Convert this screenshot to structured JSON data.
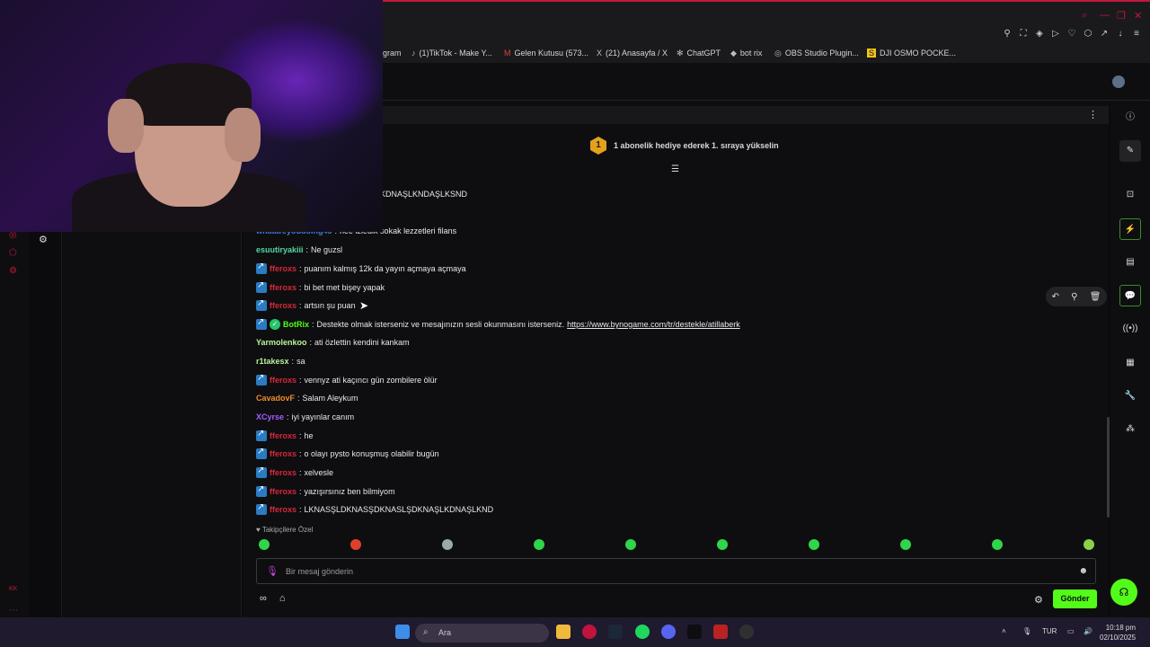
{
  "bookmarks": [
    {
      "label": "gram",
      "icon": ""
    },
    {
      "label": "(1)TikTok - Make Y...",
      "icon": "♪"
    },
    {
      "label": "Gelen Kutusu (573...",
      "icon": "M"
    },
    {
      "label": "(21) Anasayfa / X",
      "icon": "X"
    },
    {
      "label": "ChatGPT",
      "icon": "✻"
    },
    {
      "label": "bot rix",
      "icon": "◆"
    },
    {
      "label": "OBS Studio Plugin...",
      "icon": "◎"
    },
    {
      "label": "DJI OSMO POCKE...",
      "icon": "S"
    }
  ],
  "pinned": {
    "badge": "1",
    "text": "1 abonelik hediye ederek 1. sıraya yükselin"
  },
  "partial_line": "KDNAŞLKNDAŞLKSND",
  "messages": [
    {
      "user": "whatareyoudoing45",
      "color": "#3d7fe0",
      "text": "nee izledik sokak lezzetleri filans"
    },
    {
      "user": "esuutiryakiii",
      "color": "#55d6a0",
      "text": "Ne guzsl"
    },
    {
      "user": "fferoxs",
      "color": "#d6283c",
      "text": "puanım kalmış 12k da yayın açmaya açmaya",
      "badge": true
    },
    {
      "user": "fferoxs",
      "color": "#d6283c",
      "text": "bi bet met bişey yapak",
      "badge": true
    },
    {
      "user": "fferoxs",
      "color": "#d6283c",
      "text": "artsın şu puan",
      "badge": true
    },
    {
      "user": "BotRix",
      "color": "#53fc18",
      "text": "Destekte olmak isterseniz ve mesajınızın sesli okunmasını isterseniz.",
      "link": "https://www.bynogame.com/tr/destekle/atillaberk",
      "badge": true,
      "verified": true
    },
    {
      "user": "Yarmolenkoo",
      "color": "#b9f29a",
      "text": "ati özlettin kendini kankam"
    },
    {
      "user": "r1takesx",
      "color": "#b9f29a",
      "text": "sa"
    },
    {
      "user": "fferoxs",
      "color": "#d6283c",
      "text": "vennyz ati kaçıncı gün zombilere ölür",
      "badge": true
    },
    {
      "user": "CavadovF",
      "color": "#f08a2a",
      "text": "Salam Aleykum"
    },
    {
      "user": "XCyrse",
      "color": "#a35cff",
      "text": "iyi yayınlar canım"
    },
    {
      "user": "fferoxs",
      "color": "#d6283c",
      "text": "he",
      "badge": true
    },
    {
      "user": "fferoxs",
      "color": "#d6283c",
      "text": "o olayı pysto konuşmuş olabilir bugün",
      "badge": true
    },
    {
      "user": "fferoxs",
      "color": "#d6283c",
      "text": "xelvesle",
      "badge": true
    },
    {
      "user": "fferoxs",
      "color": "#d6283c",
      "text": "yazışırsınız ben bilmiyom",
      "badge": true
    },
    {
      "user": "fferoxs",
      "color": "#d6283c",
      "text": "LKNASŞLDKNASŞDKNASLŞDKNAŞLKDNAŞLKND",
      "badge": true
    }
  ],
  "follow_label": "♥ Takipçilere Özel",
  "input": {
    "placeholder": "Bir mesaj gönderin"
  },
  "send_label": "Gönder",
  "taskbar": {
    "search": "Ara",
    "lang": "TUR",
    "time": "10:18 pm",
    "date": "02/10/2025"
  },
  "colors": {
    "accent": "#53fc18",
    "brand_red": "#c2183a"
  }
}
